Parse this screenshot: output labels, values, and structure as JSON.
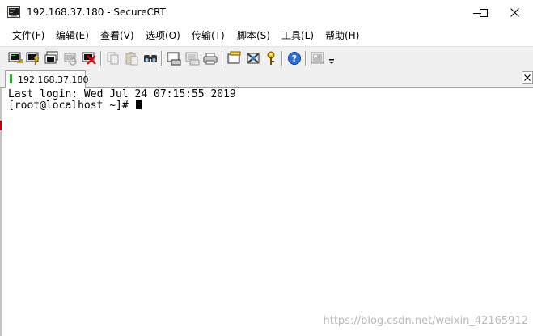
{
  "window": {
    "title": "192.168.37.180 - SecureCRT",
    "app_icon": "securecrt-terminal-icon",
    "controls": [
      "minimize-icon",
      "maximize-icon",
      "close-icon"
    ]
  },
  "menu": {
    "items": [
      {
        "label": "文件(F)"
      },
      {
        "label": "编辑(E)"
      },
      {
        "label": "查看(V)"
      },
      {
        "label": "选项(O)"
      },
      {
        "label": "传输(T)"
      },
      {
        "label": "脚本(S)"
      },
      {
        "label": "工具(L)"
      },
      {
        "label": "帮助(H)"
      }
    ]
  },
  "toolbar": {
    "icons": [
      "connect-icon",
      "quick-connect-icon",
      "connect-in-tab-icon",
      "reconnect-icon",
      "disconnect-icon",
      "copy-icon",
      "paste-icon",
      "find-icon",
      "print-icon",
      "print-setup-icon",
      "print-selection-icon",
      "session-options-icon",
      "global-options-icon",
      "keymap-icon",
      "help-icon",
      "sftp-icon",
      "toolbar-overflow-icon"
    ]
  },
  "tabs": [
    {
      "label": "192.168.37.180",
      "status": "connected",
      "status_color": "#21b427"
    }
  ],
  "terminal": {
    "lines": [
      "Last login: Wed Jul 24 07:15:55 2019",
      "[root@localhost ~]# "
    ],
    "cursor": "block"
  },
  "watermark": "https://blog.csdn.net/weixin_42165912"
}
